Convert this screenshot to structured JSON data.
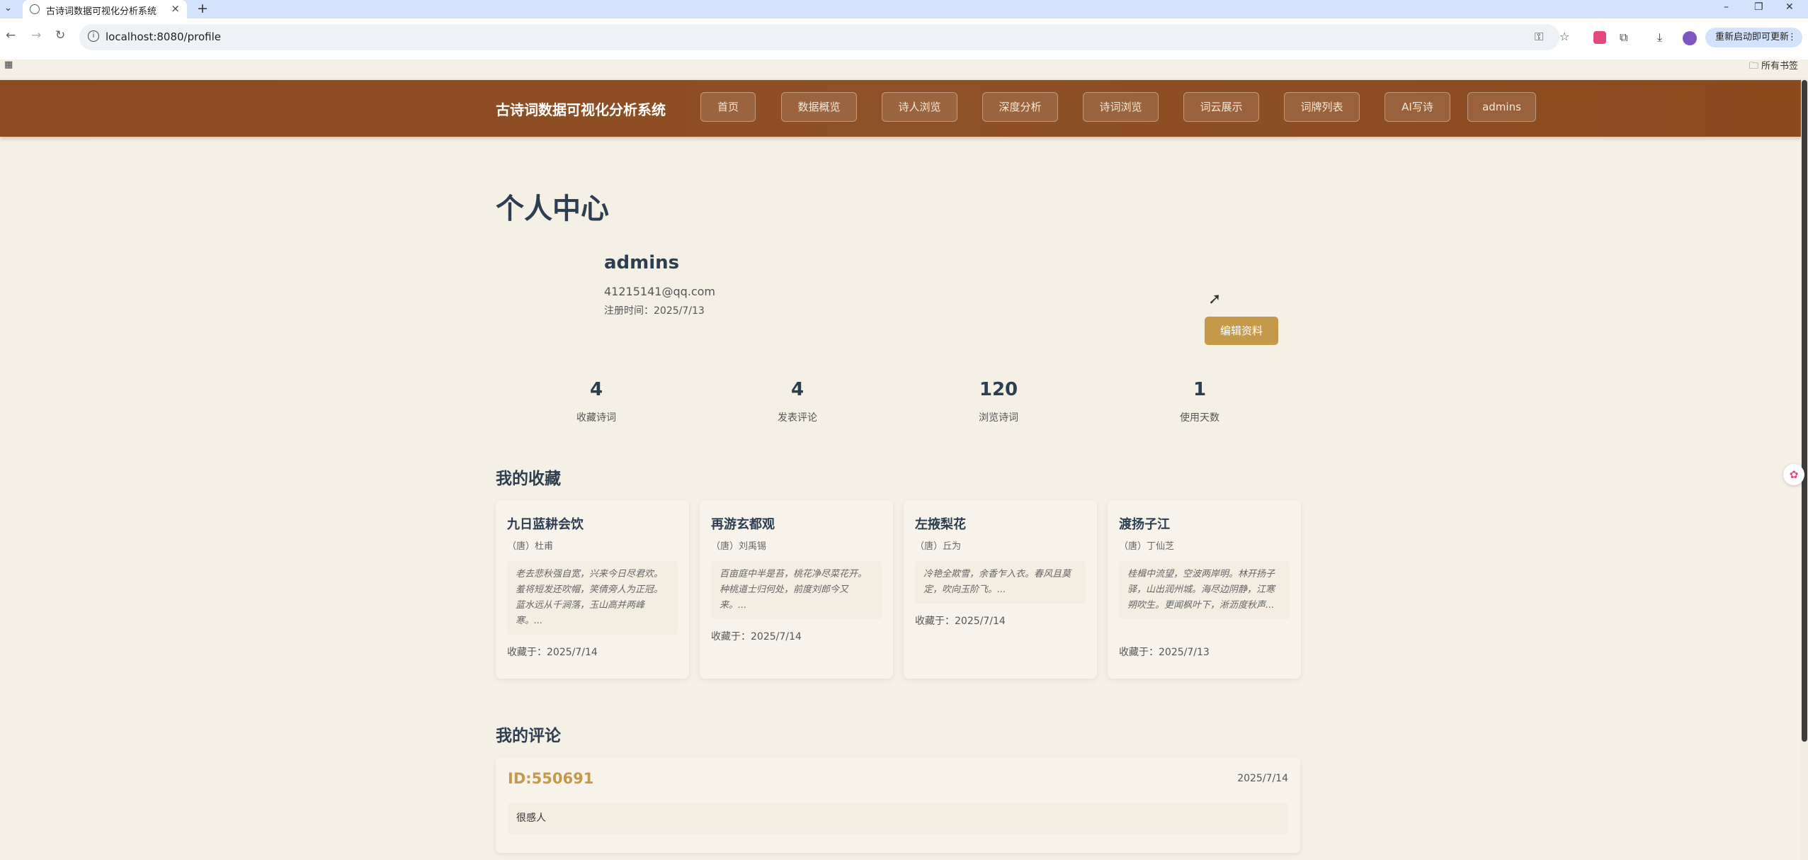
{
  "browser": {
    "tab_title": "古诗词数据可视化分析系统",
    "url": "localhost:8080/profile",
    "update_button": "重新启动即可更新",
    "bookmarks_label": "所有书签"
  },
  "site": {
    "logo": "古诗词数据可视化分析系统",
    "nav": [
      {
        "label": "首页"
      },
      {
        "label": "数据概览"
      },
      {
        "label": "诗人浏览"
      },
      {
        "label": "深度分析"
      },
      {
        "label": "诗词浏览"
      },
      {
        "label": "词云展示"
      },
      {
        "label": "词牌列表"
      },
      {
        "label": "AI写诗"
      },
      {
        "label": "admins"
      }
    ]
  },
  "profile": {
    "page_title": "个人中心",
    "username": "admins",
    "email": "41215141@qq.com",
    "registered": "注册时间：2025/7/13",
    "edit_button": "编辑资料"
  },
  "stats": [
    {
      "value": "4",
      "label": "收藏诗词"
    },
    {
      "value": "4",
      "label": "发表评论"
    },
    {
      "value": "120",
      "label": "浏览诗词"
    },
    {
      "value": "1",
      "label": "使用天数"
    }
  ],
  "favorites": {
    "title": "我的收藏",
    "items": [
      {
        "title": "九日蓝耕会饮",
        "author": "（唐）杜甫",
        "excerpt": "老去悲秋强自宽，兴来今日尽君欢。羞将短发还吹帽，笑倩旁人为正冠。蓝水远从千涧落，玉山高并两峰寒。...",
        "date": "收藏于：2025/7/14"
      },
      {
        "title": "再游玄都观",
        "author": "（唐）刘禹锡",
        "excerpt": "百亩庭中半是苔，桃花净尽菜花开。种桃道士归何处，前度刘郎今又来。...",
        "date": "收藏于：2025/7/14"
      },
      {
        "title": "左掖梨花",
        "author": "（唐）丘为",
        "excerpt": "冷艳全欺雪，余香乍入衣。春风且莫定，吹向玉阶飞。...",
        "date": "收藏于：2025/7/14"
      },
      {
        "title": "渡扬子江",
        "author": "（唐）丁仙芝",
        "excerpt": "桂楫中流望，空波两岸明。林开扬子驿，山出润州城。海尽边阴静，江寒朔吹生。更闻枫叶下，淅沥度秋声...",
        "date": "收藏于：2025/7/13"
      }
    ]
  },
  "comments": {
    "title": "我的评论",
    "items": [
      {
        "id": "ID:550691",
        "date": "2025/7/14",
        "text": "很感人"
      }
    ]
  }
}
